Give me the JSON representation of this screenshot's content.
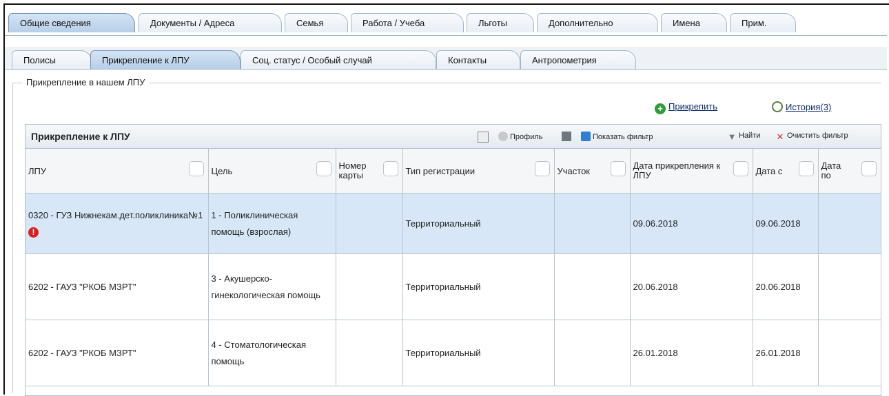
{
  "tabs_top": [
    "Общие сведения",
    "Документы / Адреса",
    "Семья",
    "Работа / Учеба",
    "Льготы",
    "Дополнительно",
    "Имена",
    "Прим."
  ],
  "tabs_sub": [
    "Полисы",
    "Прикрепление к ЛПУ",
    "Соц. статус / Особый случай",
    "Контакты",
    "Антропометрия"
  ],
  "section_legend": "Прикрепление в нашем ЛПУ",
  "actions": {
    "attach": "Прикрепить",
    "history": "История(3)"
  },
  "grid": {
    "title": "Прикрепление к ЛПУ",
    "toolbar": {
      "profile": "Профиль",
      "show_filter": "Показать фильтр",
      "find": "Найти",
      "clear_filter": "Очистить фильтр"
    },
    "columns": [
      "ЛПУ",
      "Цель",
      "Номер карты",
      "Тип регистрации",
      "Участок",
      "Дата прикрепления к ЛПУ",
      "Дата с",
      "Дата по"
    ],
    "rows": [
      {
        "lpu": "0320 - ГУЗ Нижнекам.дет.поликлиника№1",
        "goal": "1 - Поликлиническая помощь (взрослая)",
        "card": "",
        "reg_type": "Территориальный",
        "area": "",
        "attach_date": "09.06.2018",
        "date_from": "09.06.2018",
        "date_to": ""
      },
      {
        "lpu": "6202 - ГАУЗ \"РКОБ МЗРТ\"",
        "goal": "3 - Акушерско-гинекологическая помощь",
        "card": "",
        "reg_type": "Территориальный",
        "area": "",
        "attach_date": "20.06.2018",
        "date_from": "20.06.2018",
        "date_to": ""
      },
      {
        "lpu": "6202 - ГАУЗ \"РКОБ МЗРТ\"",
        "goal": "4 - Стоматологическая помощь",
        "card": "",
        "reg_type": "Территориальный",
        "area": "",
        "attach_date": "26.01.2018",
        "date_from": "26.01.2018",
        "date_to": ""
      }
    ]
  },
  "colors": {
    "selected_row": "#d7e7f7",
    "active_tab": "#b6cfe8",
    "warning": "#d81e1e",
    "add_icon": "#2e9d3a"
  }
}
